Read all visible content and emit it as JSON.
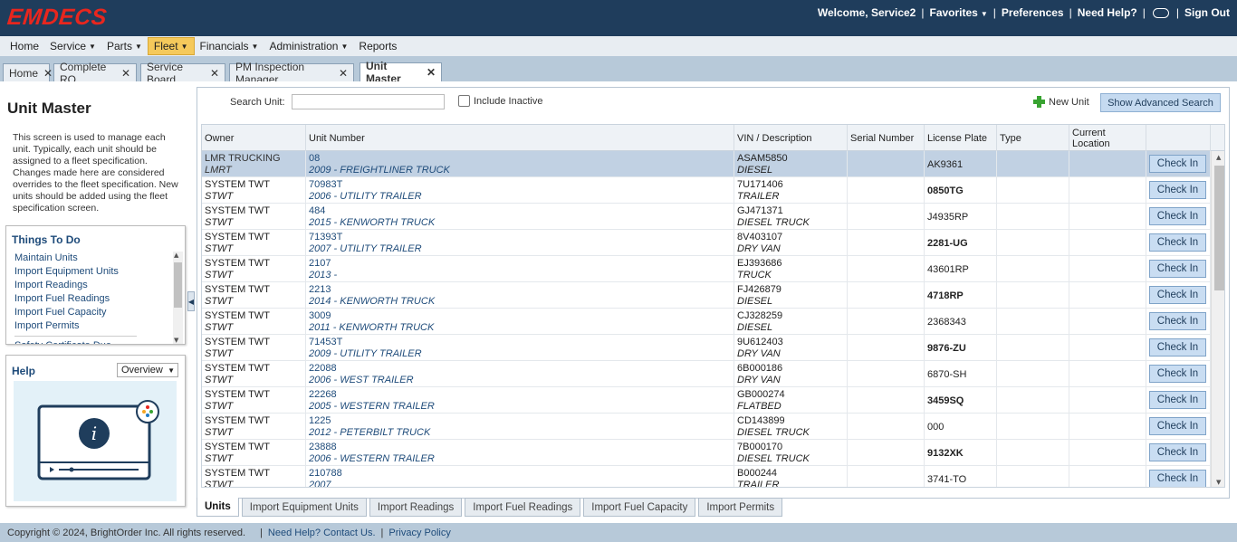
{
  "header": {
    "logo": "EMDECS",
    "welcome": "Welcome, Service2",
    "favorites": "Favorites",
    "preferences": "Preferences",
    "need_help": "Need Help?",
    "sign_out": "Sign Out"
  },
  "menu": [
    "Home",
    "Service",
    "Parts",
    "Fleet",
    "Financials",
    "Administration",
    "Reports"
  ],
  "menu_dropdown": [
    false,
    true,
    true,
    true,
    true,
    true,
    false
  ],
  "menu_active_index": 3,
  "tabs": [
    {
      "label": "Home",
      "active": false
    },
    {
      "label": "Complete RO",
      "active": false
    },
    {
      "label": "Service Board",
      "active": false
    },
    {
      "label": "PM Inspection Manager",
      "active": false
    },
    {
      "label": "Unit Master",
      "active": true
    }
  ],
  "left": {
    "title": "Unit Master",
    "description": "This screen is used to manage each unit. Typically, each unit should be assigned to a fleet specification. Changes made here are considered overrides to the fleet specification. New units should be added using the fleet specification screen.",
    "todo_title": "Things To Do",
    "todo_items": [
      "Maintain Units",
      "Import Equipment Units",
      "Import Readings",
      "Import Fuel Readings",
      "Import Fuel Capacity",
      "Import Permits"
    ],
    "todo_extra": "Safety Certificate Due Dates",
    "help_title": "Help",
    "help_select": "Overview"
  },
  "toolbar": {
    "search_label": "Search Unit:",
    "search_value": "",
    "include_inactive": "Include Inactive",
    "new_unit": "New Unit",
    "advanced_search": "Show Advanced Search"
  },
  "columns": [
    "Owner",
    "Unit Number",
    "VIN / Description",
    "Serial Number",
    "License Plate",
    "Type",
    "Current Location"
  ],
  "rows": [
    {
      "owner": "LMR TRUCKING",
      "owner_code": "LMRT",
      "unit": "08",
      "unit_desc": "2009 - FREIGHTLINER TRUCK",
      "vin": "ASAM5850",
      "vin_desc": "DIESEL",
      "serial": "",
      "plate": "AK9361",
      "plate_bold": false,
      "type": "",
      "location": "",
      "selected": true
    },
    {
      "owner": "SYSTEM TWT",
      "owner_code": "STWT",
      "unit": "70983T",
      "unit_desc": "2006 - UTILITY TRAILER",
      "vin": "7U171406",
      "vin_desc": "TRAILER",
      "serial": "",
      "plate": "0850TG",
      "plate_bold": true,
      "type": "",
      "location": "",
      "selected": false
    },
    {
      "owner": "SYSTEM TWT",
      "owner_code": "STWT",
      "unit": "484",
      "unit_desc": "2015 - KENWORTH TRUCK",
      "vin": "GJ471371",
      "vin_desc": "DIESEL TRUCK",
      "serial": "",
      "plate": "J4935RP",
      "plate_bold": false,
      "type": "",
      "location": "",
      "selected": false
    },
    {
      "owner": "SYSTEM TWT",
      "owner_code": "STWT",
      "unit": "71393T",
      "unit_desc": "2007 - UTILITY TRAILER",
      "vin": "8V403107",
      "vin_desc": "DRY VAN",
      "serial": "",
      "plate": "2281-UG",
      "plate_bold": true,
      "type": "",
      "location": "",
      "selected": false
    },
    {
      "owner": "SYSTEM TWT",
      "owner_code": "STWT",
      "unit": "2107",
      "unit_desc": "2013 -",
      "vin": "EJ393686",
      "vin_desc": "TRUCK",
      "serial": "",
      "plate": "43601RP",
      "plate_bold": false,
      "type": "",
      "location": "",
      "selected": false
    },
    {
      "owner": "SYSTEM TWT",
      "owner_code": "STWT",
      "unit": "2213",
      "unit_desc": "2014 - KENWORTH TRUCK",
      "vin": "FJ426879",
      "vin_desc": "DIESEL",
      "serial": "",
      "plate": "4718RP",
      "plate_bold": true,
      "type": "",
      "location": "",
      "selected": false
    },
    {
      "owner": "SYSTEM TWT",
      "owner_code": "STWT",
      "unit": "3009",
      "unit_desc": "2011 - KENWORTH TRUCK",
      "vin": "CJ328259",
      "vin_desc": "DIESEL",
      "serial": "",
      "plate": "2368343",
      "plate_bold": false,
      "type": "",
      "location": "",
      "selected": false
    },
    {
      "owner": "SYSTEM TWT",
      "owner_code": "STWT",
      "unit": "71453T",
      "unit_desc": "2009 - UTILITY TRAILER",
      "vin": "9U612403",
      "vin_desc": "DRY VAN",
      "serial": "",
      "plate": "9876-ZU",
      "plate_bold": true,
      "type": "",
      "location": "",
      "selected": false
    },
    {
      "owner": "SYSTEM TWT",
      "owner_code": "STWT",
      "unit": "22088",
      "unit_desc": "2006 - WEST TRAILER",
      "vin": "6B000186",
      "vin_desc": "DRY VAN",
      "serial": "",
      "plate": "6870-SH",
      "plate_bold": false,
      "type": "",
      "location": "",
      "selected": false
    },
    {
      "owner": "SYSTEM TWT",
      "owner_code": "STWT",
      "unit": "22268",
      "unit_desc": "2005 - WESTERN TRAILER",
      "vin": "GB000274",
      "vin_desc": "FLATBED",
      "serial": "",
      "plate": "3459SQ",
      "plate_bold": true,
      "type": "",
      "location": "",
      "selected": false
    },
    {
      "owner": "SYSTEM TWT",
      "owner_code": "STWT",
      "unit": "1225",
      "unit_desc": "2012 - PETERBILT TRUCK",
      "vin": "CD143899",
      "vin_desc": "DIESEL TRUCK",
      "serial": "",
      "plate": "000",
      "plate_bold": false,
      "type": "",
      "location": "",
      "selected": false
    },
    {
      "owner": "SYSTEM TWT",
      "owner_code": "STWT",
      "unit": "23888",
      "unit_desc": "2006 - WESTERN TRAILER",
      "vin": "7B000170",
      "vin_desc": "DIESEL TRUCK",
      "serial": "",
      "plate": "9132XK",
      "plate_bold": true,
      "type": "",
      "location": "",
      "selected": false
    },
    {
      "owner": "SYSTEM TWT",
      "owner_code": "STWT",
      "unit": "210788",
      "unit_desc": "2007",
      "vin": "B000244",
      "vin_desc": "TRAILER",
      "serial": "",
      "plate": "3741-TO",
      "plate_bold": false,
      "type": "",
      "location": "",
      "selected": false
    }
  ],
  "checkin_label": "Check In",
  "bottom_tabs": [
    {
      "label": "Units",
      "active": true
    },
    {
      "label": "Import Equipment Units",
      "active": false
    },
    {
      "label": "Import Readings",
      "active": false
    },
    {
      "label": "Import Fuel Readings",
      "active": false
    },
    {
      "label": "Import Fuel Capacity",
      "active": false
    },
    {
      "label": "Import Permits",
      "active": false
    }
  ],
  "footer": {
    "copyright": "Copyright © 2024, BrightOrder Inc. All rights reserved.",
    "help": "Need Help? Contact Us.",
    "privacy": "Privacy Policy"
  },
  "colors": {
    "header_bg": "#1f3d5c",
    "logo": "#e8261e",
    "active_menu": "#f5c95b",
    "link": "#1e4b7a",
    "selected_row": "#c1d1e3"
  }
}
